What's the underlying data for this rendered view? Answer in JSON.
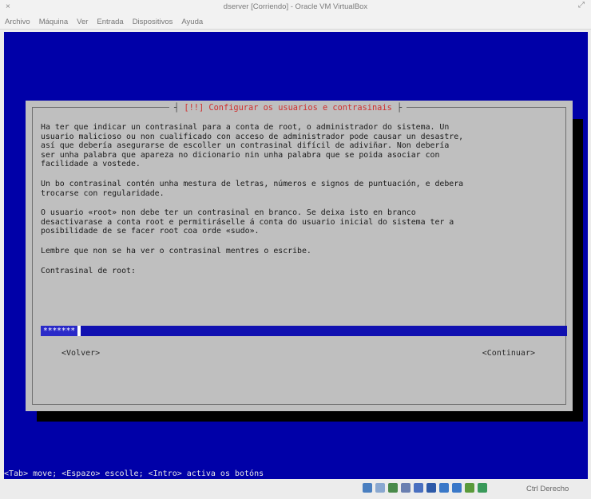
{
  "window": {
    "title": "dserver [Corriendo] - Oracle VM VirtualBox",
    "close_glyph": "×",
    "maximize_glyph": "⤢"
  },
  "menu": [
    "Archivo",
    "Máquina",
    "Ver",
    "Entrada",
    "Dispositivos",
    "Ayuda"
  ],
  "dialog": {
    "title_left": "┤",
    "title": " [!!] Configurar os usuarios e contrasinais ",
    "title_right": "├",
    "paragraph1": "Ha ter que indicar un contrasinal para a conta de root, o administrador do sistema. Un\nusuario malicioso ou non cualificado con acceso de administrador pode causar un desastre,\nasí que debería asegurarse de escoller un contrasinal difícil de adiviñar. Non debería\nser unha palabra que apareza no dicionario nin unha palabra que se poida asociar con\nfacilidade a vostede.",
    "paragraph2": "Un bo contrasinal contén unha mestura de letras, números e signos de puntuación, e debera\ntrocarse con regularidade.",
    "paragraph3": "O usuario «root» non debe ter un contrasinal en branco. Se deixa isto en branco\ndesactivarase a conta root e permitiráselle á conta do usuario inicial do sistema ter a\nposibilidade de se facer root coa orde «sudo».",
    "paragraph4": "Lembre que non se ha ver o contrasinal mentres o escribe.",
    "field_label": "Contrasinal de root:",
    "password_value": "*******",
    "back_button": "<Volver>",
    "continue_button": "<Continuar>"
  },
  "hint": "<Tab> move; <Espazo> escolle; <Intro> activa os botóns",
  "statusbar": {
    "host_key": "Ctrl Derecho",
    "icons": [
      "hard-disk-icon",
      "optical-drive-icon",
      "network-icon",
      "usb-icon",
      "shared-folders-icon",
      "display-icon",
      "video-capture-icon",
      "mouse-integration-icon",
      "cpu-icon",
      "guest-additions-icon"
    ],
    "icon_colors": [
      "#4a7fc0",
      "#8aa8d0",
      "#4a8a4a",
      "#6a7fb0",
      "#4a70c0",
      "#2d5aa8",
      "#3a78c8",
      "#3a78c8",
      "#5a9a3a",
      "#3a9a5a"
    ]
  }
}
